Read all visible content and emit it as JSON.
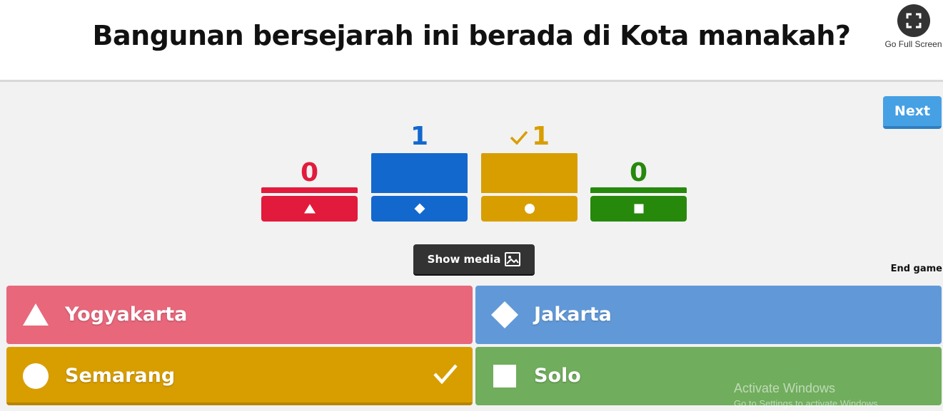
{
  "question": "Bangunan bersejarah ini berada di Kota manakah?",
  "fullscreen_label": "Go Full Screen",
  "next_label": "Next",
  "show_media_label": "Show media",
  "end_game_label": "End game",
  "colors": {
    "red": "#e21b3c",
    "blue": "#1368ce",
    "yellow": "#d89e00",
    "green": "#26890c",
    "answer_red": "#e8677b",
    "answer_blue": "#6199d8",
    "answer_yellow": "#d89e00",
    "answer_green": "#70ad5d"
  },
  "results": [
    {
      "shape": "triangle",
      "count": "0",
      "correct": false
    },
    {
      "shape": "diamond",
      "count": "1",
      "correct": false
    },
    {
      "shape": "circle",
      "count": "1",
      "correct": true
    },
    {
      "shape": "square",
      "count": "0",
      "correct": false
    }
  ],
  "answers": [
    {
      "shape": "triangle",
      "label": "Yogyakarta",
      "correct": false
    },
    {
      "shape": "diamond",
      "label": "Jakarta",
      "correct": false
    },
    {
      "shape": "circle",
      "label": "Semarang",
      "correct": true
    },
    {
      "shape": "square",
      "label": "Solo",
      "correct": false
    }
  ],
  "watermark": {
    "line1": "Activate Windows",
    "line2": "Go to Settings to activate Windows."
  }
}
